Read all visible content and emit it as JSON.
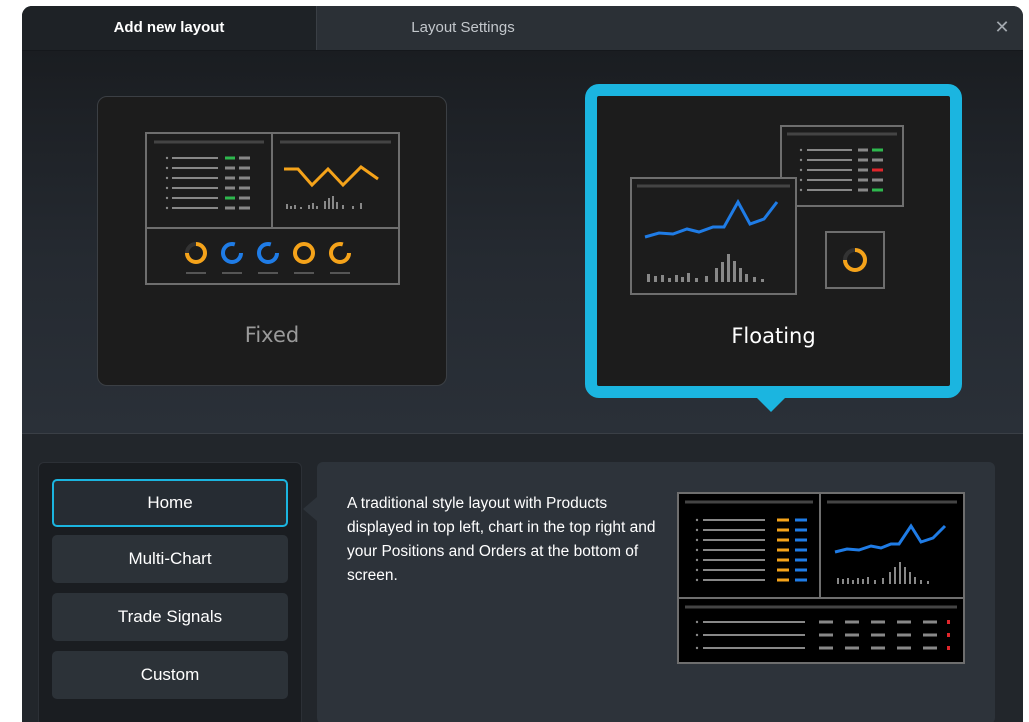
{
  "tabs": [
    {
      "label": "Add new layout",
      "active": true
    },
    {
      "label": "Layout Settings",
      "active": false
    }
  ],
  "close_icon": "close-icon",
  "layout_types": {
    "fixed": {
      "label": "Fixed",
      "selected": false
    },
    "floating": {
      "label": "Floating",
      "selected": true
    }
  },
  "presets": [
    {
      "label": "Home",
      "active": true
    },
    {
      "label": "Multi-Chart",
      "active": false
    },
    {
      "label": "Trade Signals",
      "active": false
    },
    {
      "label": "Custom",
      "active": false
    }
  ],
  "description": "A traditional style layout with Products displayed in top left, chart in the top right and your Positions and Orders at the bottom of screen.",
  "colors": {
    "accent": "#1bb5e0",
    "chart_blue": "#1f7ce6",
    "chart_orange": "#f5a31a",
    "chart_green": "#2eb84e",
    "chart_red": "#e0262b"
  }
}
